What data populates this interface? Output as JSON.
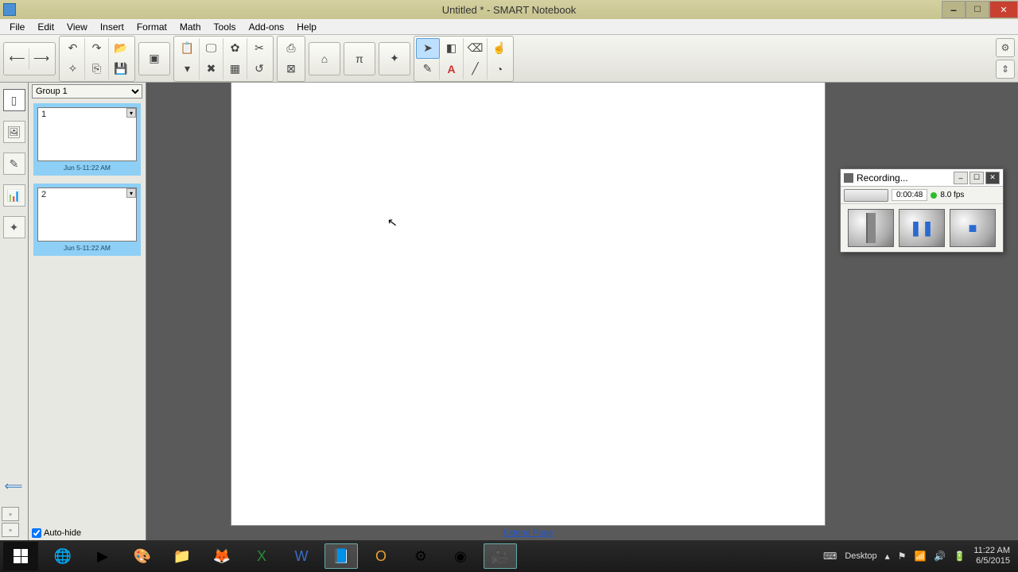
{
  "window": {
    "title": "Untitled * - SMART Notebook"
  },
  "menu": {
    "items": [
      "File",
      "Edit",
      "View",
      "Insert",
      "Format",
      "Math",
      "Tools",
      "Add-ons",
      "Help"
    ]
  },
  "sorter": {
    "group_label": "Group 1",
    "pages": [
      {
        "num": "1",
        "ts": "Jun 5-11:22 AM"
      },
      {
        "num": "2",
        "ts": "Jun 5-11:22 AM"
      }
    ],
    "autohide_label": "Auto-hide"
  },
  "canvas": {
    "extend_label": "Extend Page"
  },
  "recorder": {
    "title": "Recording...",
    "time": "0:00:48",
    "fps": "8.0 fps"
  },
  "taskbar": {
    "desktop_label": "Desktop",
    "time": "11:22 AM",
    "date": "6/5/2015"
  }
}
